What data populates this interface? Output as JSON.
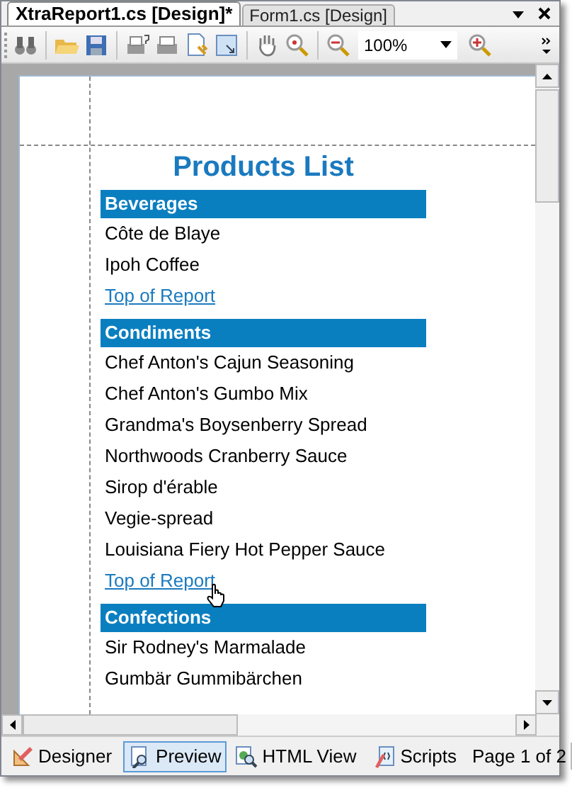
{
  "tabs": [
    {
      "label": "XtraReport1.cs [Design]*",
      "selected": true
    },
    {
      "label": "Form1.cs [Design]",
      "selected": false
    }
  ],
  "toolbar": {
    "zoom": "100%"
  },
  "report": {
    "title": "Products List",
    "groups": [
      {
        "name": "Beverages",
        "items": [
          "Côte de Blaye",
          "Ipoh Coffee"
        ],
        "link": "Top of Report"
      },
      {
        "name": "Condiments",
        "items": [
          "Chef Anton's Cajun Seasoning",
          "Chef Anton's Gumbo Mix",
          "Grandma's Boysenberry Spread",
          "Northwoods Cranberry Sauce",
          "Sirop d'érable",
          "Vegie-spread",
          "Louisiana Fiery Hot Pepper Sauce"
        ],
        "link": "Top of Report"
      },
      {
        "name": "Confections",
        "items": [
          "Sir Rodney's Marmalade",
          "Gumbär Gummibärchen"
        ]
      }
    ]
  },
  "view_tabs": [
    {
      "label": "Designer",
      "selected": false
    },
    {
      "label": "Preview",
      "selected": true
    },
    {
      "label": "HTML View",
      "selected": false
    },
    {
      "label": "Scripts",
      "selected": false
    }
  ],
  "page_status": "Page 1 of 2"
}
